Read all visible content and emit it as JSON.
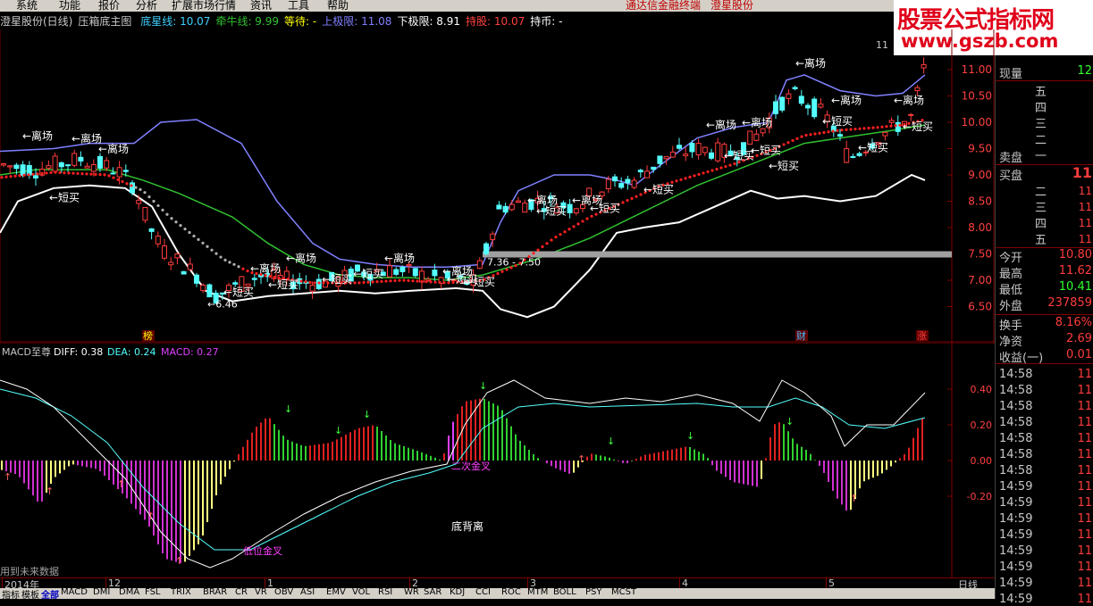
{
  "menu": [
    "系统",
    "功能",
    "报价",
    "分析",
    "扩展市场行情",
    "资讯",
    "工具",
    "帮助"
  ],
  "menu_center": "通达信金融终端",
  "menu_stock": "澄星股份",
  "title": {
    "name": "澄星股份(日线)",
    "indicator": "压箱底主图",
    "items": [
      {
        "label": "底星线:",
        "value": "10.07",
        "color": "#40d0ff"
      },
      {
        "label": "牵牛线:",
        "value": "9.99",
        "color": "#30c030"
      },
      {
        "label": "等待:",
        "value": "-",
        "color": "#ffff00"
      },
      {
        "label": "上极限:",
        "value": "11.08",
        "color": "#8080ff"
      },
      {
        "label": "下极限:",
        "value": "8.91",
        "color": "#ffffff"
      },
      {
        "label": "持股:",
        "value": "10.07",
        "color": "#ff4040"
      },
      {
        "label": "持币:",
        "value": "-",
        "color": "#ffffff"
      }
    ]
  },
  "watermark": {
    "line1": "股票公式指标网",
    "line2": "www.gszb.com"
  },
  "price_axis": [
    "11.00",
    "10.50",
    "10.00",
    "9.50",
    "9.00",
    "8.50",
    "8.00",
    "7.50",
    "7.00",
    "6.50"
  ],
  "price_axis_top": "11",
  "main_annotations": {
    "leave": "←离场",
    "short_buy": "←短买",
    "low_label": "←6.46",
    "range_label": "7.36 - 7.50",
    "bottom_markers": [
      {
        "text": "榜",
        "color": "#ffff00"
      },
      {
        "text": "财",
        "color": "#40c0ff"
      },
      {
        "text": "涨",
        "color": "#ff4040"
      }
    ]
  },
  "macd": {
    "title": "MACD至尊",
    "diff_label": "DIFF: 0.38",
    "dea_label": "DEA: 0.24",
    "macd_label": "MACD: 0.27",
    "axis": [
      "0.40",
      "0.20",
      "0.00",
      "-0.20"
    ],
    "annotations": {
      "second_cross": "二次金叉",
      "bottom_div": "底背离",
      "low_cross": "低位金叉"
    },
    "future_note": "用到未来数据"
  },
  "time_axis": [
    "2014年",
    "12",
    "1",
    "2",
    "3",
    "4",
    "5"
  ],
  "period": "日线",
  "bottom_tabs": [
    "指标",
    "模板",
    "全部",
    "MACD",
    "DMI",
    "DMA",
    "FSL",
    "TRIX",
    "BRAR",
    "CR",
    "VR",
    "OBV",
    "ASI",
    "EMV",
    "VOL",
    "RSI",
    "WR",
    "SAR",
    "KDJ",
    "CCI",
    "ROC",
    "MTM",
    "BOLL",
    "PSY",
    "MCST"
  ],
  "quote_panel": {
    "now_label": "现量",
    "now_value": "12",
    "sell_label": "卖盘",
    "buy_label": "买盘",
    "buy_value": "11",
    "sell_levels": [
      "五",
      "四",
      "三",
      "二",
      "一"
    ],
    "buy_levels": [
      "一",
      "二",
      "三",
      "四",
      "五"
    ],
    "buy_level_values": [
      "11",
      "11",
      "11",
      "11"
    ],
    "stats": [
      {
        "label": "今开",
        "value": "10.80"
      },
      {
        "label": "最高",
        "value": "11.62"
      },
      {
        "label": "最低",
        "value": "10.41"
      },
      {
        "label": "外盘",
        "value": "237859"
      },
      {
        "label": "换手",
        "value": "8.16%"
      },
      {
        "label": "净资",
        "value": "2.69"
      },
      {
        "label": "收益(一)",
        "value": "0.01"
      }
    ],
    "ticks": [
      {
        "time": "14:58",
        "value": "11"
      },
      {
        "time": "14:58",
        "value": "11"
      },
      {
        "time": "14:58",
        "value": "11"
      },
      {
        "time": "14:58",
        "value": "11"
      },
      {
        "time": "14:58",
        "value": "11"
      },
      {
        "time": "14:58",
        "value": "11"
      },
      {
        "time": "14:58",
        "value": "11"
      },
      {
        "time": "14:59",
        "value": "11"
      },
      {
        "time": "14:59",
        "value": "11"
      },
      {
        "time": "14:59",
        "value": "11"
      },
      {
        "time": "14:59",
        "value": "11"
      },
      {
        "time": "14:59",
        "value": "11"
      },
      {
        "time": "14:59",
        "value": "11"
      },
      {
        "time": "14:59",
        "value": "11"
      },
      {
        "time": "14:59",
        "value": "11"
      }
    ]
  },
  "colors": {
    "up": "#ff3c3c",
    "down": "#54ffff",
    "upper_band": "#8080ff",
    "lower_band": "#ffffff",
    "green_line": "#30c030",
    "red_dots": "#ff2020",
    "grid": "#800000"
  }
}
